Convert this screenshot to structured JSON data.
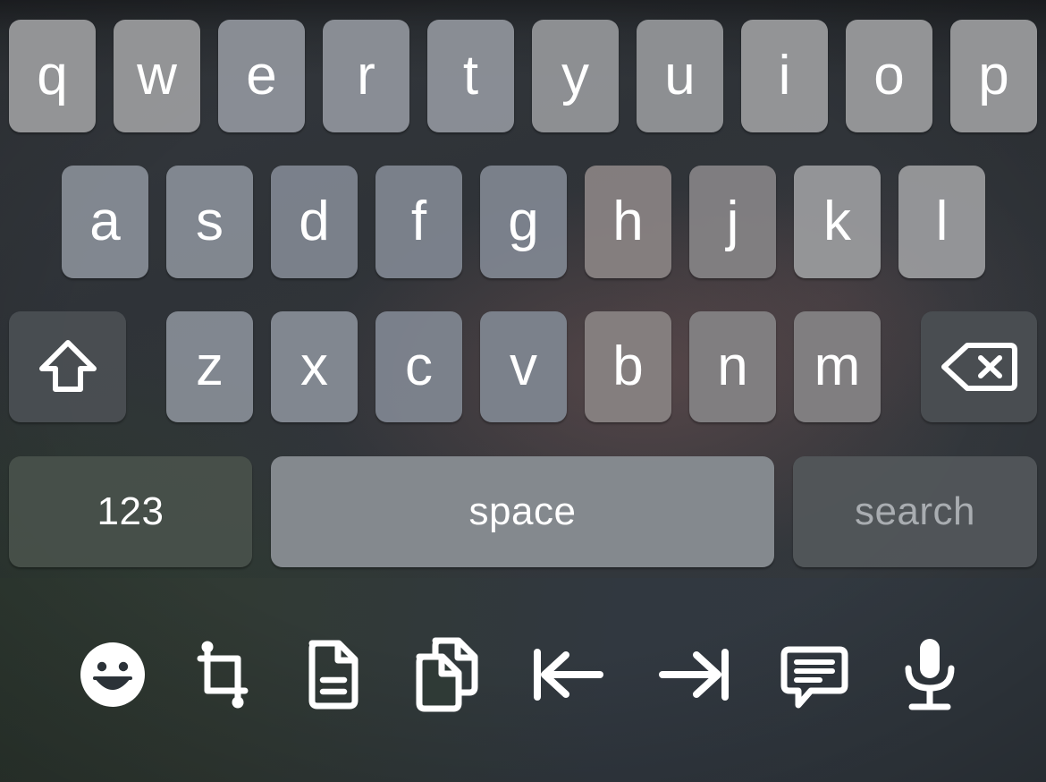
{
  "keyboard": {
    "type": "ios-qwerty-keyboard",
    "language": "en",
    "rows": {
      "row1": [
        {
          "key": "q",
          "label": "q"
        },
        {
          "key": "w",
          "label": "w"
        },
        {
          "key": "e",
          "label": "e"
        },
        {
          "key": "r",
          "label": "r"
        },
        {
          "key": "t",
          "label": "t"
        },
        {
          "key": "y",
          "label": "y"
        },
        {
          "key": "u",
          "label": "u"
        },
        {
          "key": "i",
          "label": "i"
        },
        {
          "key": "o",
          "label": "o"
        },
        {
          "key": "p",
          "label": "p"
        }
      ],
      "row2": [
        {
          "key": "a",
          "label": "a"
        },
        {
          "key": "s",
          "label": "s"
        },
        {
          "key": "d",
          "label": "d"
        },
        {
          "key": "f",
          "label": "f"
        },
        {
          "key": "g",
          "label": "g"
        },
        {
          "key": "h",
          "label": "h"
        },
        {
          "key": "j",
          "label": "j"
        },
        {
          "key": "k",
          "label": "k"
        },
        {
          "key": "l",
          "label": "l"
        }
      ],
      "row3": [
        {
          "key": "z",
          "label": "z"
        },
        {
          "key": "x",
          "label": "x"
        },
        {
          "key": "c",
          "label": "c"
        },
        {
          "key": "v",
          "label": "v"
        },
        {
          "key": "b",
          "label": "b"
        },
        {
          "key": "n",
          "label": "n"
        },
        {
          "key": "m",
          "label": "m"
        }
      ]
    },
    "shift_key": {
      "icon": "shift-arrow-up-icon",
      "label": ""
    },
    "backspace_key": {
      "icon": "backspace-delete-icon",
      "label": ""
    },
    "numbers_key": {
      "label": "123"
    },
    "space_key": {
      "label": "space"
    },
    "return_key": {
      "label": "search",
      "state": "dimmed"
    }
  },
  "toolbar": {
    "items": [
      {
        "name": "emoji-icon",
        "label": "Emoji"
      },
      {
        "name": "crop-icon",
        "label": "Crop"
      },
      {
        "name": "document-icon",
        "label": "Document"
      },
      {
        "name": "copy-documents-icon",
        "label": "Copy"
      },
      {
        "name": "move-to-start-icon",
        "label": "Move to start"
      },
      {
        "name": "move-to-end-icon",
        "label": "Move to end"
      },
      {
        "name": "message-bubble-icon",
        "label": "Message"
      },
      {
        "name": "microphone-icon",
        "label": "Dictate"
      }
    ]
  },
  "colors": {
    "key_light": "#94989b",
    "key_dark": "#4a4e52",
    "key_space": "#878c92",
    "text_primary": "#ffffff",
    "text_dim": "#a9adb1",
    "background_top": "#30353a",
    "background_toolbar": "#313a34"
  }
}
